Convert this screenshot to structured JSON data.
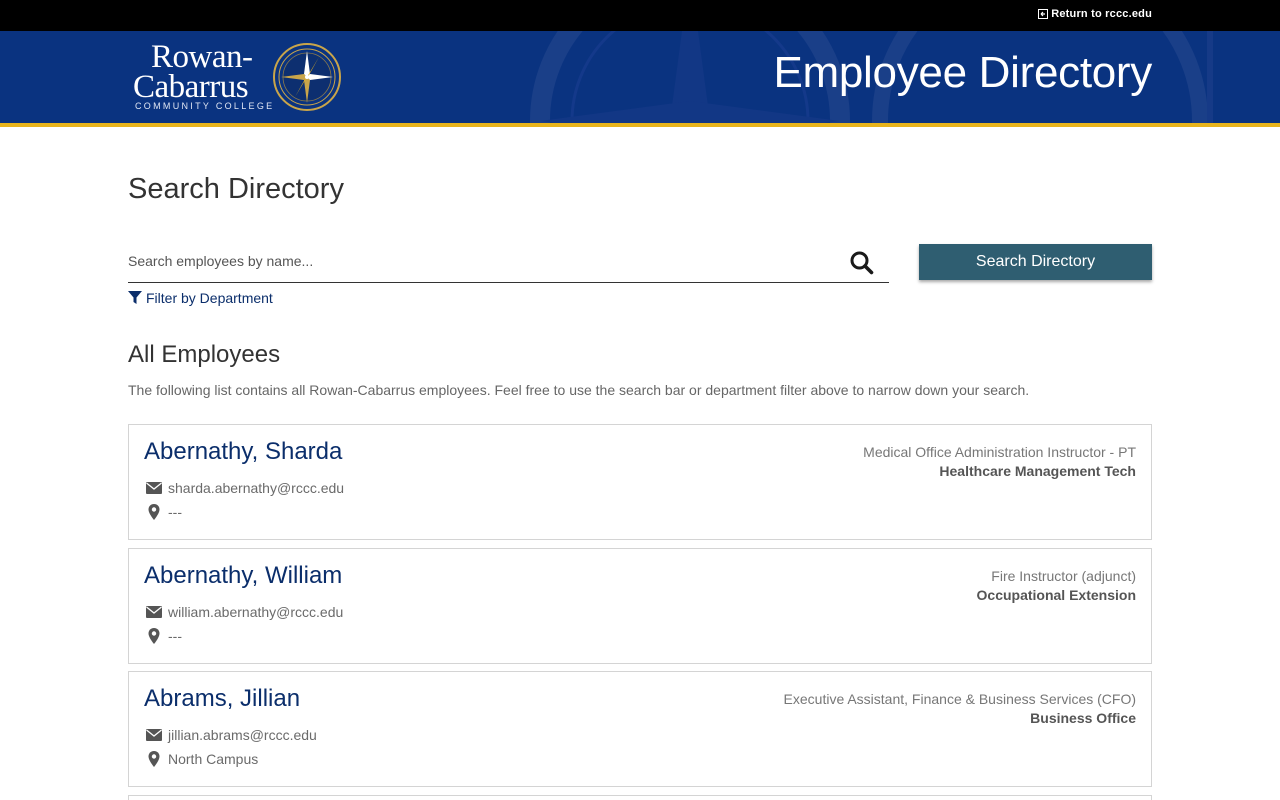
{
  "topbar": {
    "return_label": "Return to rccc.edu"
  },
  "header": {
    "logo_line1": "Rowan-",
    "logo_line2": "Cabarrus",
    "logo_line3": "COMMUNITY COLLEGE",
    "title": "Employee Directory"
  },
  "search": {
    "heading": "Search Directory",
    "placeholder": "Search employees by name...",
    "button_label": "Search Directory",
    "filter_label": "Filter by Department"
  },
  "list": {
    "heading": "All Employees",
    "description": "The following list contains all Rowan-Cabarrus employees. Feel free to use the search bar or department filter above to narrow down your search.",
    "employees": [
      {
        "name": "Abernathy, Sharda",
        "email": "sharda.abernathy@rccc.edu",
        "location": "---",
        "title": "Medical Office Administration Instructor - PT",
        "department": "Healthcare Management Tech"
      },
      {
        "name": "Abernathy, William",
        "email": "william.abernathy@rccc.edu",
        "location": "---",
        "title": "Fire Instructor (adjunct)",
        "department": "Occupational Extension"
      },
      {
        "name": "Abrams, Jillian",
        "email": "jillian.abrams@rccc.edu",
        "location": "North Campus",
        "title": "Executive Assistant, Finance & Business Services (CFO)",
        "department": "Business Office"
      }
    ]
  },
  "colors": {
    "topbar": "#000000",
    "header_blue": "#0a3380",
    "header_gold_rule": "#e8b41c",
    "button": "#2f5e71",
    "link_navy": "#0b2e6b"
  },
  "icons": [
    "external-link-icon",
    "compass-logo-icon",
    "search-icon",
    "filter-icon",
    "envelope-icon",
    "map-marker-icon"
  ]
}
